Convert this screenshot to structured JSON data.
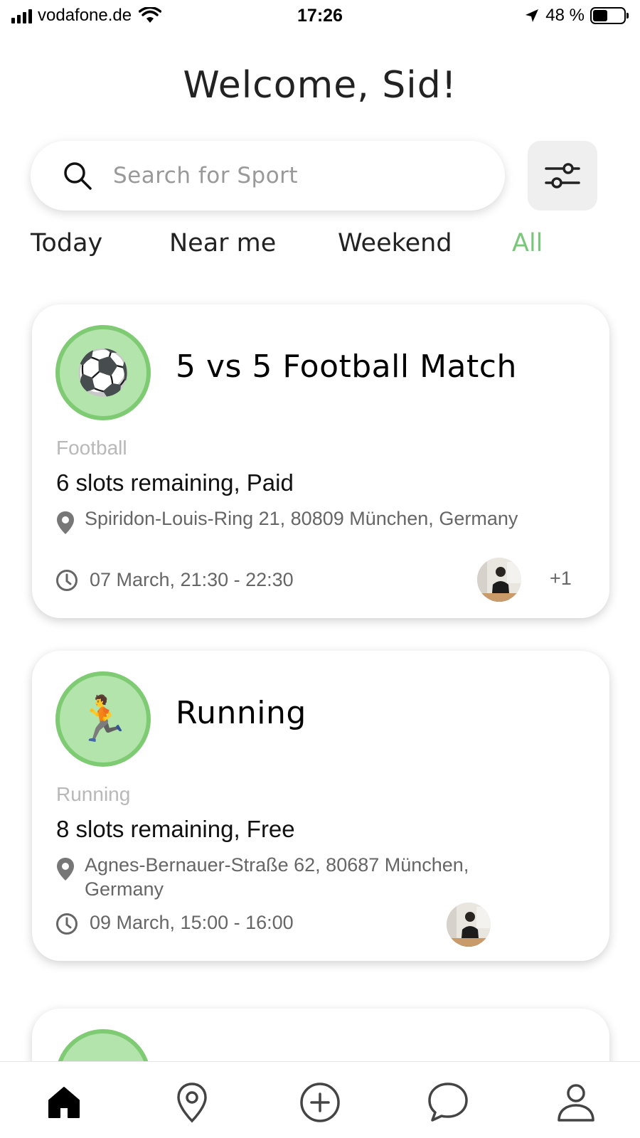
{
  "status_bar": {
    "carrier": "vodafone.de",
    "time": "17:26",
    "battery_percent": "48 %",
    "battery_level": 0.48
  },
  "header": {
    "welcome": "Welcome, Sid!"
  },
  "search": {
    "placeholder": "Search for Sport"
  },
  "filter_tabs": [
    {
      "label": "Today",
      "active": false
    },
    {
      "label": "Near me",
      "active": false
    },
    {
      "label": "Weekend",
      "active": false
    },
    {
      "label": "All",
      "active": true
    }
  ],
  "events": [
    {
      "icon": "soccer-ball-icon",
      "emoji": "⚽",
      "title": "5 vs 5 Football Match",
      "category": "Football",
      "slots": "6 slots remaining, Paid",
      "address": "Spiridon-Louis-Ring 21, 80809 München, Germany",
      "time": "07 March, 21:30 - 22:30",
      "extra_participants": "+1"
    },
    {
      "icon": "runner-icon",
      "emoji": "🏃",
      "title": "Running",
      "category": "Running",
      "slots": "8 slots remaining, Free",
      "address": "Agnes-Bernauer-Straße 62, 80687 München, Germany",
      "time": "09 March, 15:00 - 16:00"
    }
  ],
  "bottom_nav": [
    {
      "name": "home",
      "icon": "home-icon",
      "active": true
    },
    {
      "name": "map",
      "icon": "location-pin-icon",
      "active": false
    },
    {
      "name": "create",
      "icon": "plus-circle-icon",
      "active": false
    },
    {
      "name": "chat",
      "icon": "chat-bubble-icon",
      "active": false
    },
    {
      "name": "profile",
      "icon": "person-icon",
      "active": false
    }
  ],
  "colors": {
    "accent_green": "#7ac77a",
    "icon_circle_fill": "#b2e4ac",
    "icon_circle_border": "#7fcb73"
  }
}
